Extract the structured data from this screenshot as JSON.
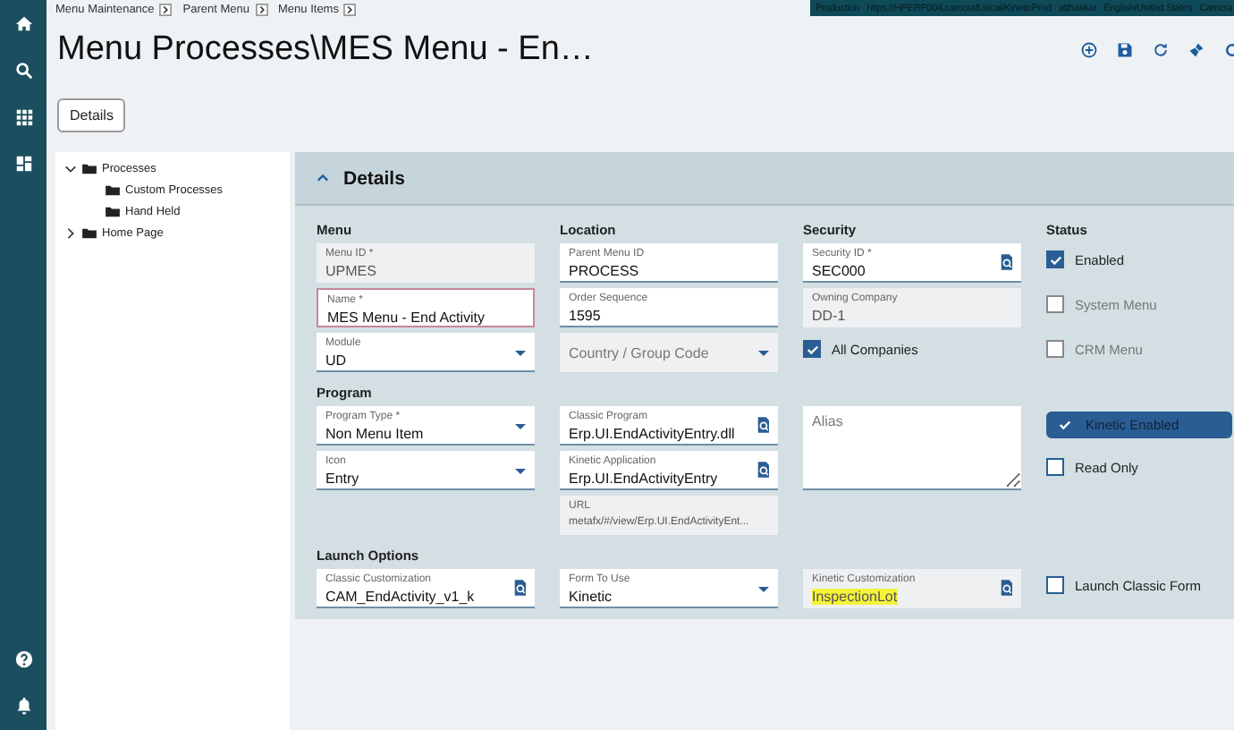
{
  "breadcrumbs": [
    "Menu Maintenance",
    "Parent Menu",
    "Menu Items"
  ],
  "environment_bar": [
    "Production",
    "https://HPERP004.camcraft.local/KineticProd",
    "atthakkar",
    "English/United States",
    "Camcra"
  ],
  "page_title": "Menu Processes\\MES Menu - En…",
  "tabs": [
    {
      "label": "Details",
      "selected": true
    }
  ],
  "tree": {
    "items": [
      {
        "label": "Processes",
        "expanded": true,
        "children": [
          {
            "label": "Custom Processes"
          },
          {
            "label": "Hand Held"
          }
        ]
      },
      {
        "label": "Home Page",
        "expanded": false
      }
    ]
  },
  "details": {
    "title": "Details",
    "expanded": true,
    "rows": [
      [
        {
          "kind": "heading",
          "text": "Menu"
        },
        {
          "kind": "heading",
          "text": "Location"
        },
        {
          "kind": "heading",
          "text": "Security"
        },
        {
          "kind": "heading",
          "text": "Status"
        }
      ],
      [
        {
          "kind": "text",
          "label": "Menu ID *",
          "value": "UPMES",
          "readonly": true,
          "focused": false
        },
        {
          "kind": "text",
          "label": "Parent Menu ID",
          "value": "PROCESS",
          "readonly": false,
          "focused": false
        },
        {
          "kind": "lookup",
          "label": "Security ID *",
          "value": "SEC000",
          "readonly": false,
          "focused": false
        },
        {
          "kind": "checkbox",
          "label": "Enabled",
          "checked": true,
          "disabled": false
        }
      ],
      [
        {
          "kind": "text",
          "label": "Name *",
          "value": "MES Menu - End Activity",
          "readonly": false,
          "focused": true
        },
        {
          "kind": "text",
          "label": "Order Sequence",
          "value": "1595",
          "readonly": false,
          "focused": false
        },
        {
          "kind": "text",
          "label": "Owning Company",
          "value": "DD-1",
          "readonly": true,
          "focused": false
        },
        {
          "kind": "checkbox",
          "label": "System Menu",
          "checked": false,
          "disabled": true
        }
      ],
      [
        {
          "kind": "dropdown",
          "label": "Module",
          "value": "UD",
          "readonly": false,
          "focused": false
        },
        {
          "kind": "dropdown",
          "placeholder": "Country / Group Code",
          "readonly": true,
          "focused": false
        },
        {
          "kind": "checkbox",
          "label": "All Companies",
          "checked": true,
          "disabled": false
        },
        {
          "kind": "checkbox",
          "label": "CRM Menu",
          "checked": false,
          "disabled": true
        }
      ],
      [
        {
          "kind": "heading",
          "text": "Program"
        },
        null,
        null,
        null
      ],
      [
        {
          "kind": "dropdown",
          "label": "Program Type *",
          "value": "Non Menu Item",
          "readonly": false,
          "focused": false
        },
        {
          "kind": "lookup",
          "label": "Classic Program",
          "value": "Erp.UI.EndActivityEntry.dll",
          "readonly": false,
          "focused": false
        },
        {
          "kind": "textarea",
          "placeholder": "Alias"
        },
        {
          "kind": "toggle",
          "label": "Kinetic Enabled",
          "checked": true
        }
      ],
      [
        {
          "kind": "dropdown",
          "label": "Icon",
          "value": "Entry",
          "readonly": false,
          "focused": false
        },
        {
          "kind": "lookup",
          "label": "Kinetic Application",
          "value": "Erp.UI.EndActivityEntry",
          "readonly": false,
          "focused": false
        },
        null,
        {
          "kind": "checkbox",
          "label": "Read Only",
          "checked": false,
          "disabled": false
        }
      ],
      [
        null,
        {
          "kind": "text",
          "label": "URL",
          "value": "metafx/#/view/Erp.UI.EndActivityEnt...",
          "readonly": true,
          "focused": false
        },
        null,
        null
      ],
      [
        {
          "kind": "heading",
          "text": "Launch Options"
        },
        null,
        null,
        null
      ],
      [
        {
          "kind": "lookup",
          "label": "Classic Customization",
          "value": "CAM_EndActivity_v1_k",
          "readonly": false,
          "focused": false
        },
        {
          "kind": "dropdown",
          "label": "Form To Use",
          "value": "Kinetic",
          "readonly": false,
          "focused": false
        },
        {
          "kind": "lookup",
          "label": "Kinetic Customization",
          "value": "InspectionLot",
          "readonly": true,
          "focused": false,
          "highlighted": true
        },
        {
          "kind": "checkbox",
          "label": "Launch Classic Form",
          "checked": false,
          "disabled": false
        }
      ]
    ]
  }
}
